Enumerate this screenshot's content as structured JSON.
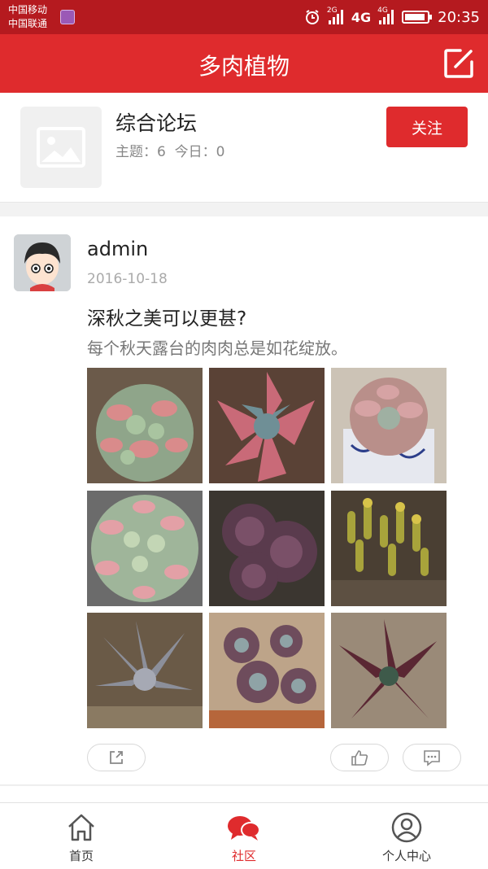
{
  "status_bar": {
    "carrier_1": "中国移动",
    "carrier_2": "中国联通",
    "network_1": "2G",
    "network_2": "4G",
    "network_3": "4G",
    "time": "20:35"
  },
  "header": {
    "title": "多肉植物",
    "edit_icon": "edit-icon"
  },
  "forum": {
    "name": "综合论坛",
    "topics_label": "主题：",
    "topics_count": "6",
    "today_label": "今日：",
    "today_count": "0",
    "follow_label": "关注"
  },
  "post": {
    "author": "admin",
    "date": "2016-10-18",
    "title": "深秋之美可以更甚?",
    "excerpt": "每个秋天露台的肉肉总是如花绽放。",
    "images": [
      "succulent-photo-1",
      "succulent-photo-2",
      "succulent-photo-3",
      "succulent-photo-4",
      "succulent-photo-5",
      "succulent-photo-6",
      "succulent-photo-7",
      "succulent-photo-8",
      "succulent-photo-9"
    ],
    "actions": [
      "share-icon",
      "like-icon",
      "comment-icon"
    ]
  },
  "bottom_nav": {
    "items": [
      {
        "label": "首页",
        "icon": "home-icon",
        "active": false
      },
      {
        "label": "社区",
        "icon": "community-icon",
        "active": true
      },
      {
        "label": "个人中心",
        "icon": "profile-icon",
        "active": false
      }
    ]
  },
  "colors": {
    "brand": "#df2b2d",
    "status_bar": "#b51a1f",
    "muted_text": "#888888"
  }
}
